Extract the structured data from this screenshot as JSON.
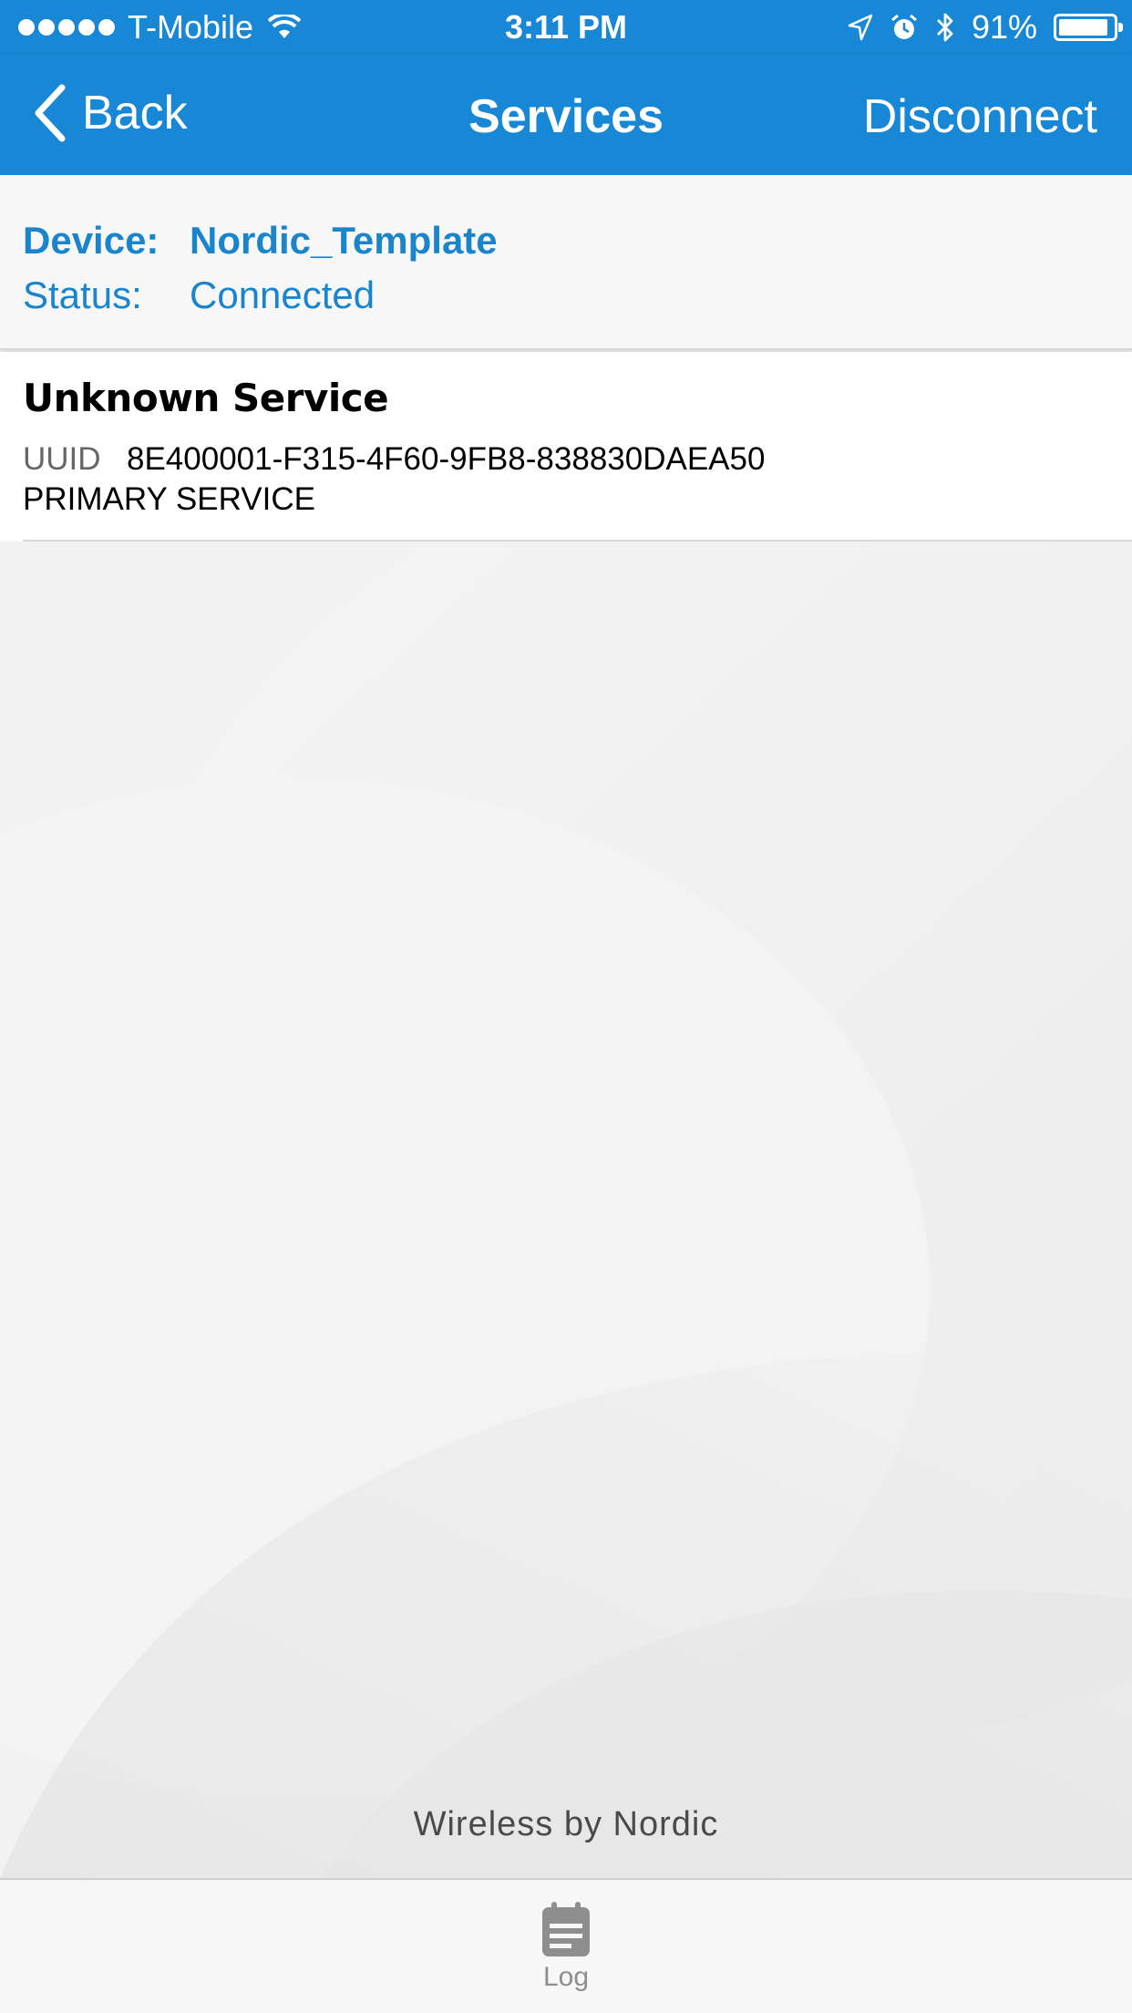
{
  "status_bar": {
    "carrier": "T-Mobile",
    "time": "3:11 PM",
    "battery_percent_label": "91%",
    "battery_level": 0.91,
    "icons": [
      "signal-dots",
      "wifi-icon",
      "location-arrow-icon",
      "alarm-icon",
      "bluetooth-icon",
      "battery-icon"
    ]
  },
  "nav": {
    "back_label": "Back",
    "title": "Services",
    "action_label": "Disconnect"
  },
  "device_panel": {
    "device_key": "Device:",
    "device_value": "Nordic_Template",
    "status_key": "Status:",
    "status_value": "Connected"
  },
  "services": [
    {
      "name": "Unknown Service",
      "uuid_label": "UUID",
      "uuid": "8E400001-F315-4F60-9FB8-838830DAEA50",
      "type": "PRIMARY SERVICE"
    }
  ],
  "footer": {
    "text": "Wireless by Nordic"
  },
  "tab_bar": {
    "items": [
      {
        "label": "Log",
        "icon": "log-icon"
      }
    ]
  },
  "colors": {
    "brand_blue": "#1787d6",
    "device_text_blue": "#1a84cd",
    "background": "#f2f2f2"
  }
}
